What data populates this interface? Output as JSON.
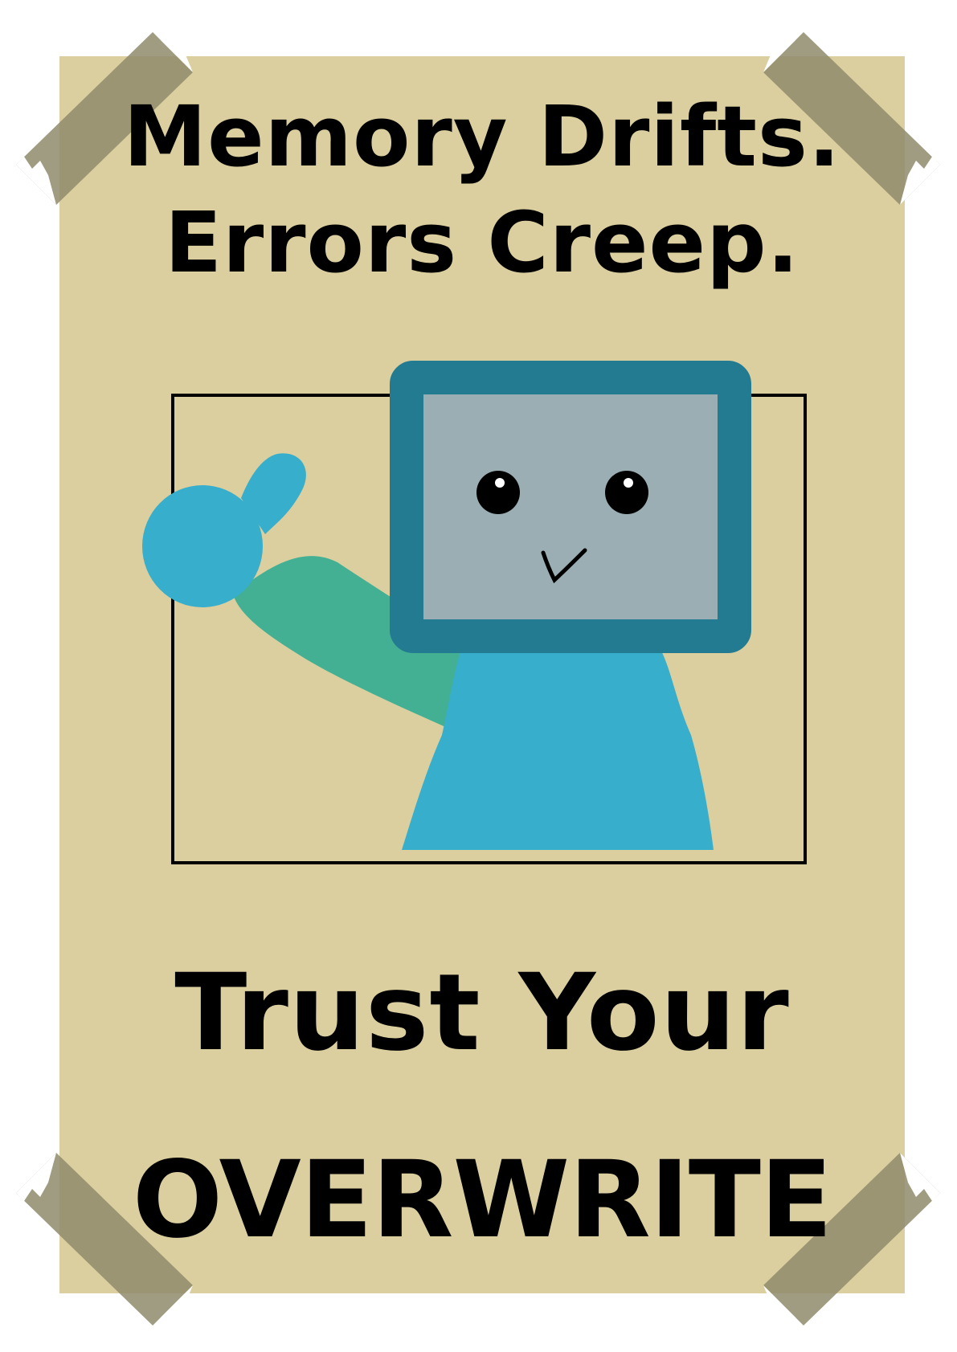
{
  "poster": {
    "headline_line_1": "Memory Drifts.",
    "headline_line_2": "Errors Creep.",
    "tagline_line_1": "Trust Your",
    "tagline_line_2": "OVERWRITE"
  },
  "colors": {
    "paper": "#dbce9f",
    "tape": "#8f8b6c",
    "screen_frame": "#227b91",
    "screen_face": "#9aaeb3",
    "body": "#37aecb",
    "arm": "#43b094",
    "ink": "#000000"
  },
  "icons": {
    "robot": "robot-mascot-illustration",
    "thumb": "thumbs-up-icon",
    "tape": "tape-corner-icon"
  }
}
